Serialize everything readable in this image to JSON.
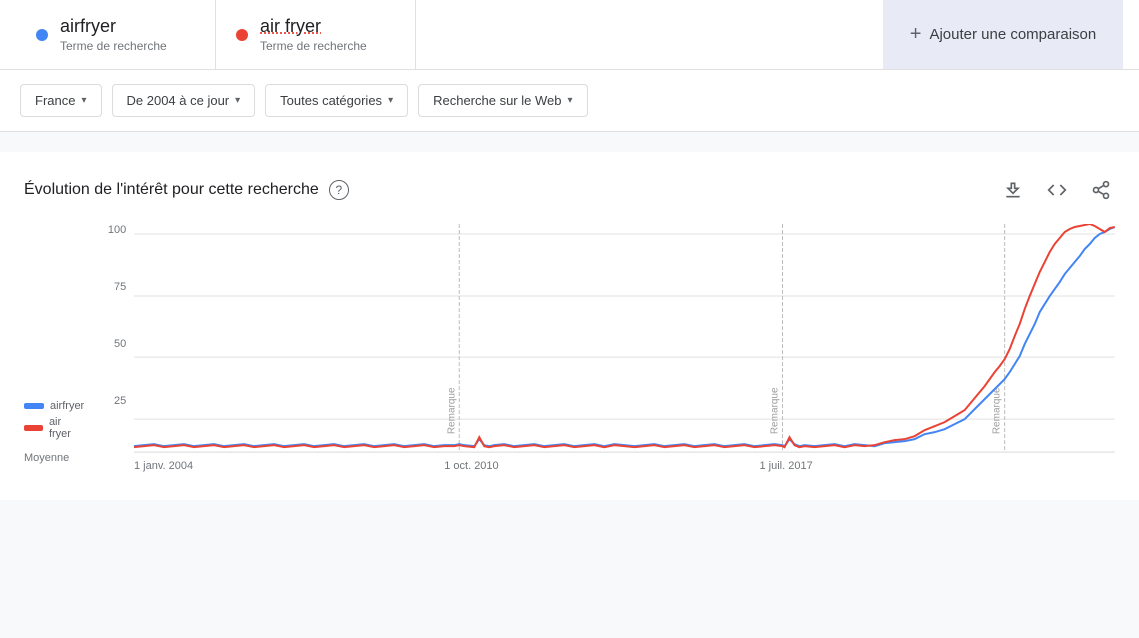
{
  "search_terms": [
    {
      "id": "term1",
      "name": "airfryer",
      "label": "Terme de recherche",
      "dot_color": "#4285f4"
    },
    {
      "id": "term2",
      "name": "air fryer",
      "label": "Terme de recherche",
      "dot_color": "#ea4335"
    }
  ],
  "add_comparison": {
    "icon": "+",
    "label": "Ajouter une comparaison"
  },
  "filters": [
    {
      "id": "country",
      "label": "France"
    },
    {
      "id": "period",
      "label": "De 2004 à ce jour"
    },
    {
      "id": "category",
      "label": "Toutes catégories"
    },
    {
      "id": "search_type",
      "label": "Recherche sur le Web"
    }
  ],
  "chart": {
    "title": "Évolution de l'intérêt pour cette recherche",
    "y_labels": [
      "100",
      "75",
      "50",
      "25",
      ""
    ],
    "x_labels": [
      "1 janv. 2004",
      "1 oct. 2010",
      "1 juil. 2017"
    ],
    "average_label": "Moyenne",
    "remarque_label": "Remarque",
    "legend": [
      {
        "color": "#4285f4",
        "label": "airfryer"
      },
      {
        "color": "#ea4335",
        "label": "air fryer"
      }
    ]
  },
  "icons": {
    "download": "↓",
    "embed": "<>",
    "share": "⤴",
    "help": "?",
    "chevron": "▾"
  }
}
